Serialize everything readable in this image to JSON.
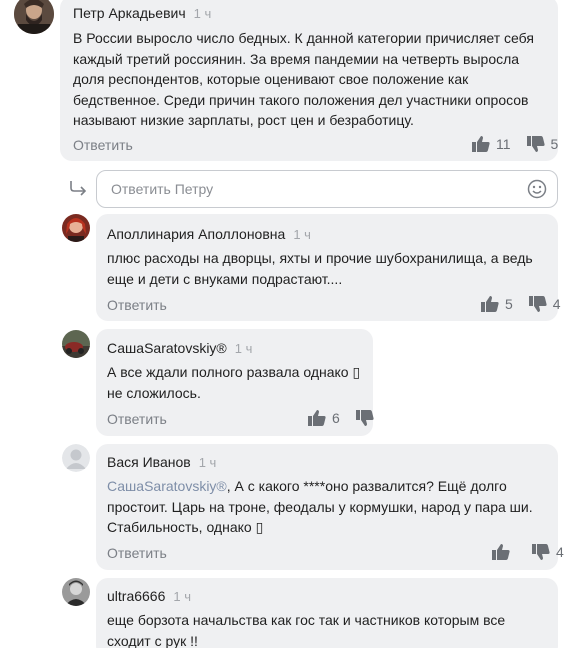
{
  "comments": [
    {
      "author": "Петр Аркадьевич",
      "time": "1 ч",
      "lines": [
        "В России выросло число бедных. К данной категории причисляет себя",
        "каждый третий россиянин. За время пандемии на четверть выросла",
        "доля респондентов, которые оценивают свое положение как",
        "бедственное. Среди причин такого положения дел участники опросов",
        "называют низкие зарплаты, рост цен и безработицу."
      ],
      "reply_label": "Ответить",
      "likes": "11",
      "dislikes": "5"
    },
    {
      "author": "Аполлинария Аполлоновна",
      "time": "1 ч",
      "lines": [
        "плюс расходы на дворцы, яхты и прочие шубохранилища, а ведь",
        "еще и дети с внуками подрастают...."
      ],
      "reply_label": "Ответить",
      "likes": "5",
      "dislikes": "4"
    },
    {
      "author": "СашаSaratovskiy®",
      "time": "1 ч",
      "lines": [
        "А все ждали полного развала однако ▯",
        "не сложилось."
      ],
      "reply_label": "Ответить",
      "likes": "6",
      "dislikes": ""
    },
    {
      "author": "Вася Иванов",
      "time": "1 ч",
      "mention": "СашаSaratovskiy®",
      "lines": [
        ", А с какого ****оно развалится? Ещё долго",
        "простоит. Царь на троне, феодалы у кормушки, народ у пара ши.",
        "Стабильность, однако ▯"
      ],
      "reply_label": "Ответить",
      "likes": "",
      "dislikes": "4"
    },
    {
      "author": "ultra6666",
      "time": "1 ч",
      "lines": [
        "еще борзота начальства как гос так и частников которым все",
        "сходит с рук !!"
      ]
    }
  ],
  "reply_box": {
    "placeholder": "Ответить Петру"
  },
  "icons": {
    "like": "thumbs-up-icon",
    "dislike": "thumbs-down-icon",
    "reply_arrow": "reply-arrow-icon",
    "emoji": "smile-icon"
  },
  "colors": {
    "bubble": "#eff0f2",
    "muted": "#a3a6ab",
    "mention": "#7e8ea8"
  }
}
